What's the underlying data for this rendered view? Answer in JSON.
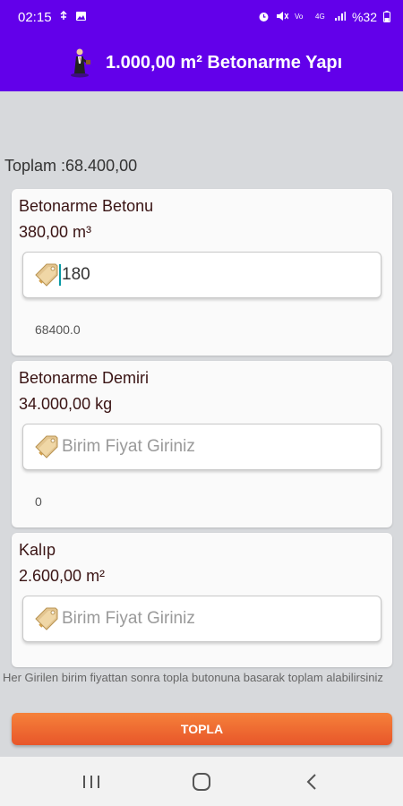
{
  "status_bar": {
    "time": "02:15",
    "battery": "%32",
    "left_icons": [
      "usb-icon",
      "gallery-icon"
    ],
    "right_icons": [
      "alarm-icon",
      "mute-icon",
      "volte-icon",
      "4g-icon",
      "signal-icon",
      "battery-icon"
    ]
  },
  "app_bar": {
    "title": "1.000,00 m² Betonarme Yapı",
    "color": "#6200ea"
  },
  "total": "Toplam :68.400,00",
  "cards": [
    {
      "title": "Betonarme Betonu",
      "amount": "380,00 m³",
      "input_value": "180",
      "input_placeholder": "Birim Fiyat Giriniz",
      "result": "68400.0"
    },
    {
      "title": "Betonarme Demiri",
      "amount": "34.000,00 kg",
      "input_value": "",
      "input_placeholder": "Birim Fiyat Giriniz",
      "result": "0"
    },
    {
      "title": "Kalıp",
      "amount": "2.600,00 m²",
      "input_value": "",
      "input_placeholder": "Birim Fiyat Giriniz"
    }
  ],
  "hint": "Her Girilen birim fiyattan sonra topla butonuna basarak toplam alabilirsiniz",
  "topla_label": "TOPLA",
  "nav": {
    "buttons": [
      "recent-apps-icon",
      "home-icon",
      "back-icon"
    ]
  }
}
